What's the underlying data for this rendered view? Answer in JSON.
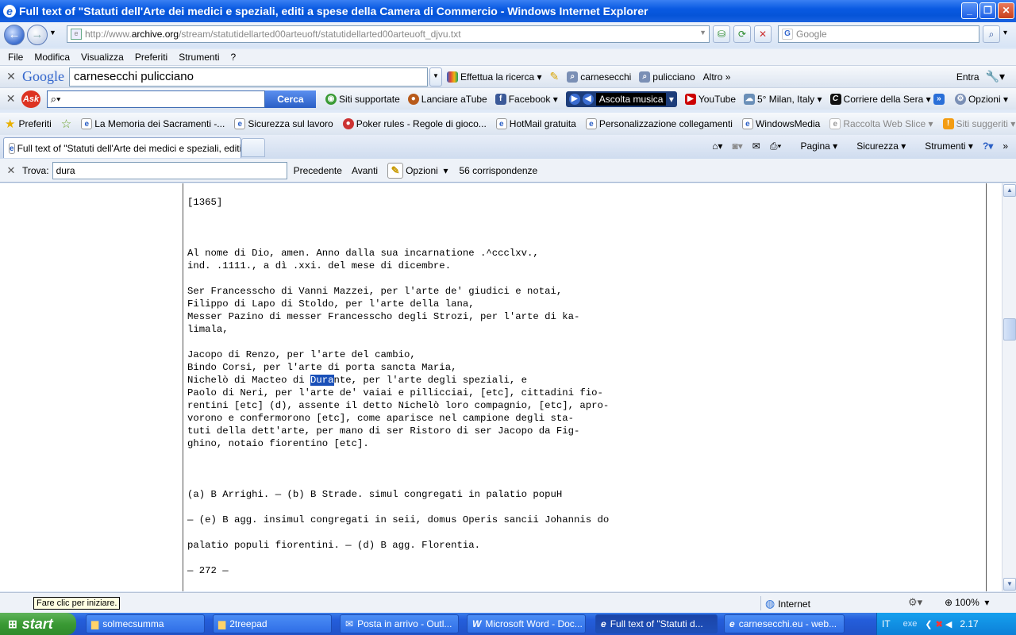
{
  "window": {
    "title": "Full text of \"Statuti dell'Arte dei medici e speziali, editi a spese della Camera di Commercio  - Windows Internet Explorer"
  },
  "address": {
    "url_prefix": "http://www.",
    "url_domain": "archive.org",
    "url_path": "/stream/statutidellarted00arteuoft/statutidellarted00arteuoft_djvu.txt",
    "search_placeholder": "Google"
  },
  "menu": [
    "File",
    "Modifica",
    "Visualizza",
    "Preferiti",
    "Strumenti",
    "?"
  ],
  "google_toolbar": {
    "logo": "Google",
    "query": "carnesecchi pulicciano",
    "search_btn": "Effettua la ricerca",
    "term1": "carnesecchi",
    "term2": "pulicciano",
    "more": "Altro",
    "login": "Entra"
  },
  "ask_toolbar": {
    "logo": "Ask",
    "search_btn": "Cerca",
    "items": [
      "Siti supportate",
      "Lanciare aTube",
      "Facebook",
      "Ascolta musica",
      "YouTube",
      "5° Milan, Italy",
      "Corriere della Sera",
      "Opzioni"
    ]
  },
  "favorites": {
    "label": "Preferiti",
    "items": [
      "La Memoria dei Sacramenti -...",
      "Sicurezza sul lavoro",
      "Poker rules - Regole di gioco...",
      "HotMail gratuita",
      "Personalizzazione collegamenti",
      "WindowsMedia",
      "Raccolta Web Slice",
      "Siti suggeriti"
    ]
  },
  "tab": {
    "title": "Full text of \"Statuti dell'Arte dei medici e speziali, editi ..."
  },
  "commandbar": [
    "Pagina",
    "Sicurezza",
    "Strumenti"
  ],
  "findbar": {
    "label": "Trova:",
    "value": "dura",
    "prev": "Precedente",
    "next": "Avanti",
    "options": "Opzioni",
    "matches": "56 corrispondenze"
  },
  "content": {
    "before_highlight": "[1365]\n\n\n\nAl nome di Dio, amen. Anno dalla sua incarnatione .^ccclxv.,\nind. .1111., a dì .xxi. del mese di dicembre.\n\nSer Francesscho di Vanni Mazzei, per l'arte de' giudici e notai,\nFilippo di Lapo di Stoldo, per l'arte della lana,\nMesser Pazino di messer Francesscho degli Strozi, per l'arte di ka-\nlimala,\n\nJacopo di Renzo, per l'arte del cambio,\nBindo Corsi, per l'arte di porta sancta Maria,\nNichelò di Macteo di ",
    "highlight": "Dura",
    "after_highlight": "nte, per l'arte degli speziali, e\nPaolo di Neri, per l'arte de' vaiai e pillicciai, [etc], cittadini fio-\nrentini [etc] (d), assente il detto Nichelò loro compagnio, [etc], apro-\nvorono e confermorono [etc], come aparisce nel campione degli sta-\ntuti della dett'arte, per mano di ser Ristoro di ser Jacopo da Fig-\nghino, notaio fiorentino [etc].\n\n\n\n(a) B Arrighi. — (b) B Strade. simul congregati in palatio popuH\n\n— (e) B agg. insimul congregati in seii, domus Operis sancii Johannis do\n\npalatio populi fiorentini. — (d) B agg. Florentia.\n\n— 272 —"
  },
  "status": {
    "tooltip": "Fare clic per iniziare.",
    "zone": "Internet",
    "zoom": "100%"
  },
  "taskbar": {
    "start": "start",
    "tasks": [
      "solmecsumma",
      "2treepad",
      "Posta in arrivo - Outl...",
      "Microsoft Word - Doc...",
      "Full text of \"Statuti d...",
      "carnesecchi.eu - web..."
    ],
    "lang": "IT",
    "exe": "exe",
    "clock": "2.17"
  },
  "colors": {
    "highlight": "#1a50b8",
    "titlebar": "#0a5ae2",
    "taskbar": "#245edb"
  }
}
